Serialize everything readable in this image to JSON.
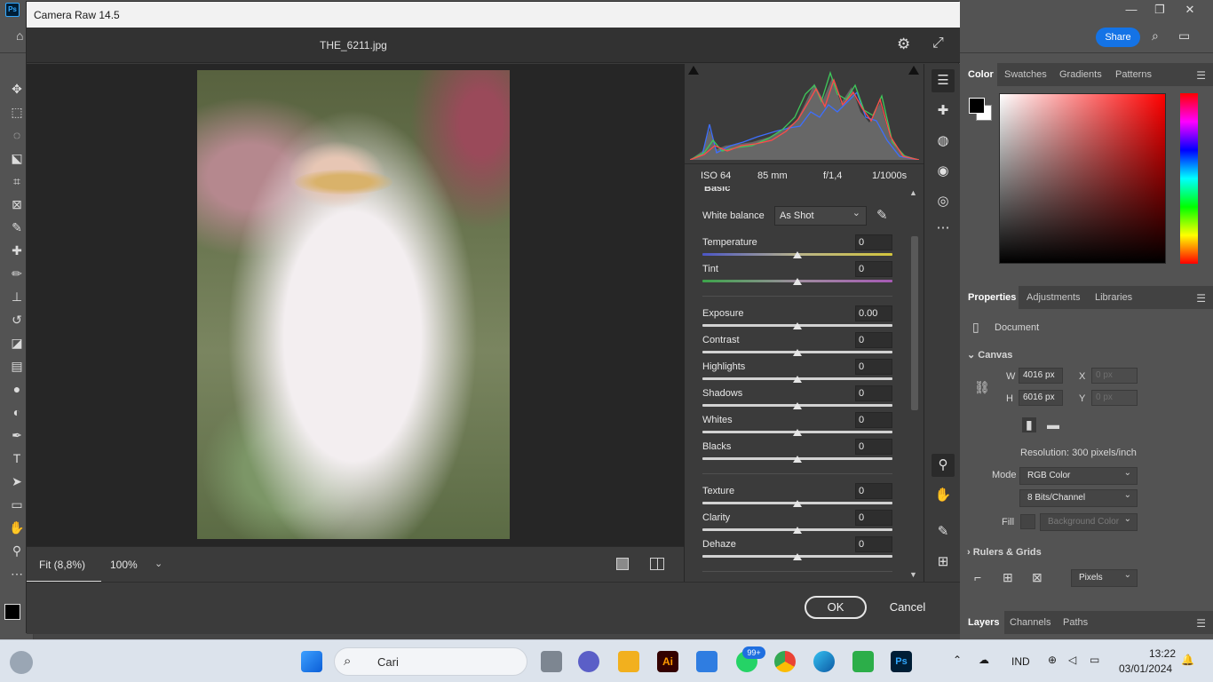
{
  "photoshop": {
    "logo": "Ps",
    "window_controls": {
      "minimize": "—",
      "maximize": "❐",
      "close": "✕"
    },
    "share_label": "Share",
    "color_panel": {
      "tabs": [
        "Color",
        "Swatches",
        "Gradients",
        "Patterns"
      ]
    },
    "properties_panel": {
      "tabs": [
        "Properties",
        "Adjustments",
        "Libraries"
      ],
      "document_label": "Document",
      "canvas_label": "Canvas",
      "w_label": "W",
      "w_value": "4016 px",
      "h_label": "H",
      "h_value": "6016 px",
      "x_label": "X",
      "x_placeholder": "0 px",
      "y_label": "Y",
      "y_placeholder": "0 px",
      "resolution": "Resolution: 300 pixels/inch",
      "mode_label": "Mode",
      "mode_value": "RGB Color",
      "depth_value": "8 Bits/Channel",
      "fill_label": "Fill",
      "fill_value": "Background Color",
      "rulers_label": "Rulers & Grids",
      "units_value": "Pixels"
    },
    "layers_tabs": [
      "Layers",
      "Channels",
      "Paths"
    ]
  },
  "camera_raw": {
    "window_title": "Camera Raw 14.5",
    "filename": "THE_6211.jpg",
    "exif": {
      "iso": "ISO 64",
      "focal": "85 mm",
      "aperture": "f/1,4",
      "shutter": "1/1000s"
    },
    "section_title": "Basic",
    "white_balance": {
      "label": "White balance",
      "value": "As Shot"
    },
    "sliders": [
      {
        "label": "Temperature",
        "value": "0"
      },
      {
        "label": "Tint",
        "value": "0"
      },
      {
        "label": "Exposure",
        "value": "0.00"
      },
      {
        "label": "Contrast",
        "value": "0"
      },
      {
        "label": "Highlights",
        "value": "0"
      },
      {
        "label": "Shadows",
        "value": "0"
      },
      {
        "label": "Whites",
        "value": "0"
      },
      {
        "label": "Blacks",
        "value": "0"
      },
      {
        "label": "Texture",
        "value": "0"
      },
      {
        "label": "Clarity",
        "value": "0"
      },
      {
        "label": "Dehaze",
        "value": "0"
      }
    ],
    "zoom_fit": "Fit (8,8%)",
    "zoom_100": "100%",
    "ok_label": "OK",
    "cancel_label": "Cancel"
  },
  "taskbar": {
    "search_placeholder": "Cari",
    "whatsapp_badge": "99+",
    "language": "IND",
    "time": "13:22",
    "date": "03/01/2024",
    "apps": [
      "windows-start",
      "search",
      "task-view",
      "meet",
      "file-explorer",
      "illustrator",
      "microsoft-store",
      "whatsapp",
      "chrome",
      "edge",
      "green-app",
      "photoshop"
    ]
  }
}
